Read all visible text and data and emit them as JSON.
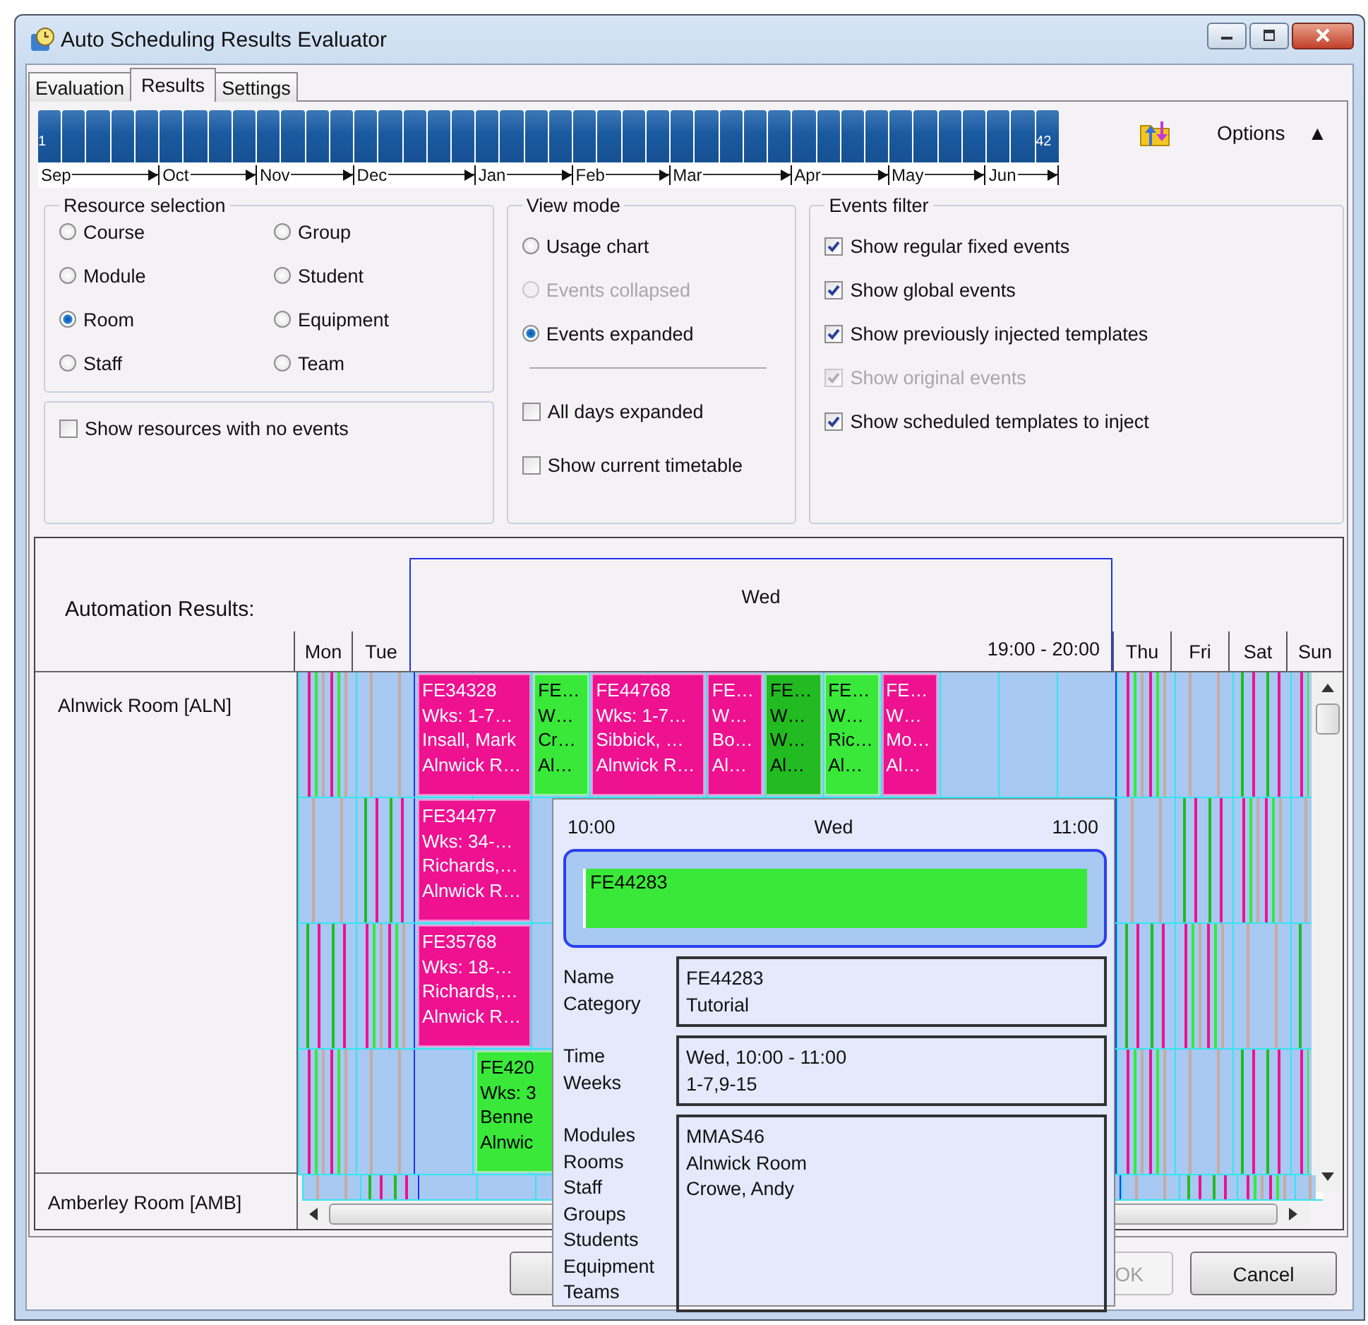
{
  "window": {
    "title": "Auto Scheduling Results Evaluator"
  },
  "tabs": [
    {
      "label": "Evaluation",
      "selected": false
    },
    {
      "label": "Results",
      "selected": true
    },
    {
      "label": "Settings",
      "selected": false
    }
  ],
  "timeline": {
    "months": [
      {
        "label": "Sep",
        "weeks": [
          {
            "selected": true,
            "label": "1"
          },
          {
            "selected": true
          },
          {
            "selected": true
          },
          {
            "selected": true
          },
          {
            "selected": true
          }
        ]
      },
      {
        "label": "Oct",
        "weeks": [
          {
            "selected": true
          },
          {
            "selected": true
          },
          {
            "selected": true
          },
          {
            "selected": true
          }
        ]
      },
      {
        "label": "Nov",
        "weeks": [
          {
            "selected": true
          },
          {
            "selected": true
          },
          {
            "selected": true
          },
          {
            "selected": true
          }
        ]
      },
      {
        "label": "Dec",
        "weeks": [
          {
            "selected": true
          },
          {
            "selected": true
          },
          {
            "selected": true
          },
          {
            "selected": true
          },
          {
            "selected": true
          }
        ]
      },
      {
        "label": "Jan",
        "weeks": [
          {
            "selected": true
          },
          {
            "selected": true
          },
          {
            "selected": true
          },
          {
            "selected": true
          }
        ]
      },
      {
        "label": "Feb",
        "weeks": [
          {
            "selected": true
          },
          {
            "selected": true
          },
          {
            "selected": true
          },
          {
            "selected": true
          }
        ]
      },
      {
        "label": "Mar",
        "weeks": [
          {
            "selected": true
          },
          {
            "selected": true
          },
          {
            "selected": true
          },
          {
            "selected": true
          },
          {
            "selected": true
          }
        ]
      },
      {
        "label": "Apr",
        "weeks": [
          {
            "selected": true
          },
          {
            "selected": true
          },
          {
            "selected": true
          },
          {
            "selected": true
          }
        ]
      },
      {
        "label": "May",
        "weeks": [
          {
            "selected": true
          },
          {
            "selected": true
          },
          {
            "selected": true
          },
          {
            "selected": true
          }
        ]
      },
      {
        "label": "Jun",
        "weeks": [
          {
            "selected": true
          },
          {
            "selected": true
          },
          {
            "selected": true,
            "label": "42"
          }
        ]
      }
    ]
  },
  "options": {
    "label": "Options",
    "toggle": "▲"
  },
  "resource_selection": {
    "title": "Resource selection",
    "options": [
      {
        "label": "Course",
        "selected": false
      },
      {
        "label": "Group",
        "selected": false
      },
      {
        "label": "Module",
        "selected": false
      },
      {
        "label": "Student",
        "selected": false
      },
      {
        "label": "Room",
        "selected": true
      },
      {
        "label": "Equipment",
        "selected": false
      },
      {
        "label": "Staff",
        "selected": false
      },
      {
        "label": "Team",
        "selected": false
      }
    ],
    "show_empty": {
      "label": "Show resources with no events",
      "checked": false
    }
  },
  "view_mode": {
    "title": "View mode",
    "options": [
      {
        "label": "Usage chart",
        "selected": false,
        "disabled": false
      },
      {
        "label": "Events collapsed",
        "selected": false,
        "disabled": true
      },
      {
        "label": "Events expanded",
        "selected": true,
        "disabled": false
      }
    ],
    "checks": [
      {
        "label": "All days expanded",
        "checked": false
      },
      {
        "label": "Show current timetable",
        "checked": false
      }
    ]
  },
  "events_filter": {
    "title": "Events filter",
    "checks": [
      {
        "label": "Show regular fixed events",
        "checked": true,
        "disabled": false
      },
      {
        "label": "Show global events",
        "checked": true,
        "disabled": false
      },
      {
        "label": "Show previously injected templates",
        "checked": true,
        "disabled": false
      },
      {
        "label": "Show original events",
        "checked": true,
        "disabled": true
      },
      {
        "label": "Show scheduled templates to inject",
        "checked": true,
        "disabled": false
      }
    ]
  },
  "results": {
    "title": "Automation Results:",
    "days": [
      {
        "label": "Mon",
        "selected": false
      },
      {
        "label": "Tue",
        "selected": false
      },
      {
        "label": "Wed",
        "selected": true,
        "range": "19:00 - 20:00"
      },
      {
        "label": "Thu",
        "selected": false
      },
      {
        "label": "Fri",
        "selected": false
      },
      {
        "label": "Sat",
        "selected": false
      },
      {
        "label": "Sun",
        "selected": false
      }
    ],
    "resources": [
      {
        "name": "Alnwick Room [ALN]",
        "rows": [
          {
            "events": [
              {
                "kind": "wide",
                "color": "#ee1190",
                "lines": [
                  "FE34328",
                  "Wks: 1-7…",
                  "Insall, Mark",
                  "Alnwick R…"
                ]
              },
              {
                "kind": "narrow",
                "color": "#3ae83a",
                "lines": [
                  "FE…",
                  "W…",
                  "Cr…",
                  "Al…"
                ]
              },
              {
                "kind": "wide",
                "color": "#ee1190",
                "lines": [
                  "FE44768",
                  "Wks: 1-7…",
                  "Sibbick, …",
                  "Alnwick R…"
                ]
              },
              {
                "kind": "narrow",
                "color": "#ee1190",
                "lines": [
                  "FE…",
                  "W…",
                  "Bo…",
                  "Al…"
                ]
              },
              {
                "kind": "narrow",
                "color": "#22bb22",
                "lines": [
                  "FE…",
                  "W…",
                  "W…",
                  "Al…"
                ]
              },
              {
                "kind": "narrow",
                "color": "#3ae83a",
                "lines": [
                  "FE…",
                  "W…",
                  "Ric…",
                  "Al…"
                ]
              },
              {
                "kind": "narrow",
                "color": "#ee1190",
                "lines": [
                  "FE…",
                  "W…",
                  "Mo…",
                  "Al…"
                ]
              }
            ]
          },
          {
            "events": [
              {
                "kind": "wide",
                "color": "#ee1190",
                "lines": [
                  "FE34477",
                  "Wks: 34-…",
                  "Richards,…",
                  "Alnwick R…"
                ]
              }
            ]
          },
          {
            "events": [
              {
                "kind": "wide",
                "color": "#ee1190",
                "lines": [
                  "FE35768",
                  "Wks: 18-…",
                  "Richards,…",
                  "Alnwick R…"
                ]
              }
            ]
          },
          {
            "events": [
              {
                "kind": "gap"
              },
              {
                "kind": "wide",
                "color": "#3ae83a",
                "lines": [
                  "FE420",
                  "Wks: 3",
                  "Benne",
                  "Alnwic"
                ]
              }
            ]
          }
        ]
      },
      {
        "name": "Amberley Room [AMB]"
      }
    ]
  },
  "popup": {
    "start": "10:00",
    "day": "Wed",
    "end": "11:00",
    "event": {
      "name": "FE44283",
      "color": "#3ae83a"
    },
    "groups": [
      {
        "fields": [
          {
            "label": "Name",
            "value": "FE44283"
          },
          {
            "label": "Category",
            "value": "Tutorial"
          }
        ]
      },
      {
        "fields": [
          {
            "label": "Time",
            "value": "Wed, 10:00 - 11:00"
          },
          {
            "label": "Weeks",
            "value": "1-7,9-15"
          }
        ]
      },
      {
        "fields": [
          {
            "label": "Modules",
            "value": "MMAS46"
          },
          {
            "label": "Rooms",
            "value": "Alnwick Room"
          },
          {
            "label": "Staff",
            "value": "Crowe, Andy"
          },
          {
            "label": "Groups"
          },
          {
            "label": "Students"
          },
          {
            "label": "Equipment"
          },
          {
            "label": "Teams"
          }
        ]
      }
    ]
  },
  "buttons": [
    {
      "label": "OK",
      "disabled": true
    },
    {
      "label": "Cancel",
      "disabled": false
    }
  ]
}
